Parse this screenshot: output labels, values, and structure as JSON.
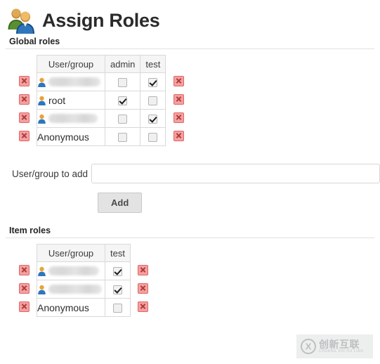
{
  "header": {
    "title": "Assign Roles",
    "icon": "two-users-icon"
  },
  "global_section": {
    "heading": "Global roles",
    "table": {
      "columns": [
        "User/group",
        "admin",
        "test"
      ],
      "rows": [
        {
          "name": "",
          "redacted": true,
          "has_person_icon": true,
          "checks": {
            "admin": false,
            "test": true
          },
          "delete_label": "delete"
        },
        {
          "name": "root",
          "redacted": false,
          "has_person_icon": true,
          "checks": {
            "admin": true,
            "test": false
          },
          "delete_label": "delete"
        },
        {
          "name": "",
          "redacted": true,
          "has_person_icon": true,
          "checks": {
            "admin": false,
            "test": true
          },
          "delete_label": "delete"
        },
        {
          "name": "Anonymous",
          "redacted": false,
          "has_person_icon": false,
          "checks": {
            "admin": false,
            "test": false
          },
          "delete_label": "delete"
        }
      ]
    }
  },
  "add_form": {
    "label": "User/group to add",
    "input_value": "",
    "input_placeholder": "",
    "button_label": "Add"
  },
  "item_section": {
    "heading": "Item roles",
    "table": {
      "columns": [
        "User/group",
        "test"
      ],
      "rows": [
        {
          "name": "",
          "redacted": true,
          "has_person_icon": true,
          "checks": {
            "test": true
          },
          "delete_label": "delete"
        },
        {
          "name": "",
          "redacted": true,
          "has_person_icon": true,
          "checks": {
            "test": true
          },
          "delete_label": "delete"
        },
        {
          "name": "Anonymous",
          "redacted": false,
          "has_person_icon": false,
          "checks": {
            "test": false
          },
          "delete_label": "delete"
        }
      ]
    }
  },
  "watermark": {
    "cn": "创新互联",
    "pinyin": "CHUANG XIN HU LIAN",
    "logo": "cx-circle-logo"
  },
  "colors": {
    "delete_red": "#f4a0a0",
    "delete_red_border": "#e06666",
    "header_bg": "#f5f5f5",
    "border": "#d9d9d9",
    "rule": "#e2e2e2",
    "button_bg": "#e3e3e3"
  }
}
